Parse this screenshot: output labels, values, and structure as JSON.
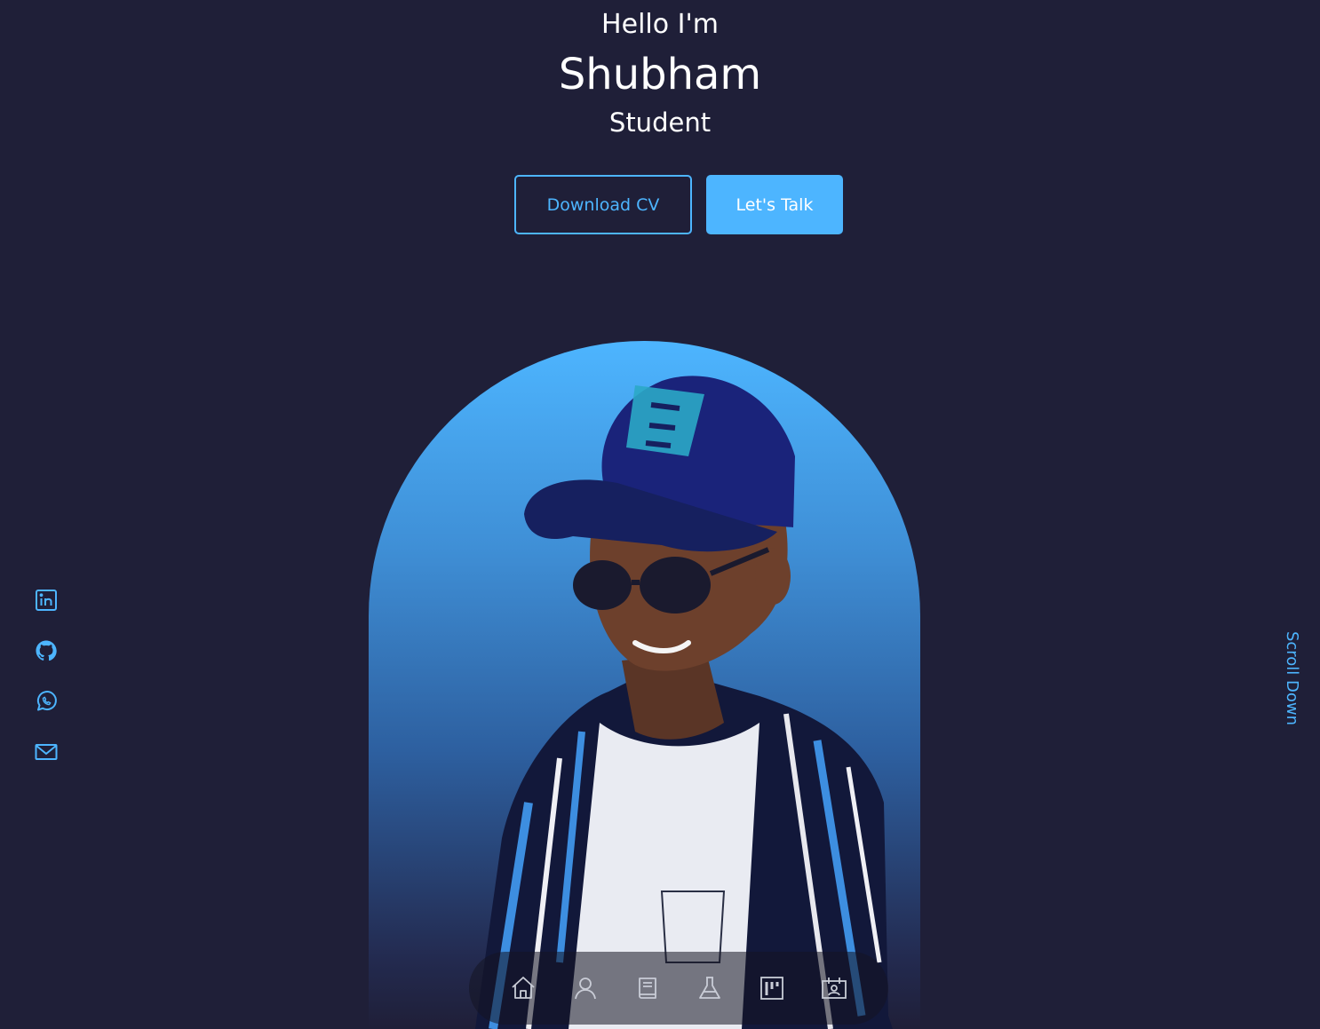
{
  "header": {
    "greeting": "Hello I'm",
    "name": "Shubham",
    "role": "Student"
  },
  "cta": {
    "download_label": "Download CV",
    "talk_label": "Let's Talk"
  },
  "scroll": {
    "label": "Scroll Down"
  },
  "socials": [
    {
      "icon": "linkedin-icon"
    },
    {
      "icon": "github-icon"
    },
    {
      "icon": "whatsapp-icon"
    },
    {
      "icon": "mail-icon"
    }
  ],
  "nav": [
    {
      "icon": "home-icon"
    },
    {
      "icon": "user-icon"
    },
    {
      "icon": "book-icon"
    },
    {
      "icon": "flask-icon"
    },
    {
      "icon": "board-icon"
    },
    {
      "icon": "contact-card-icon"
    }
  ],
  "colors": {
    "background": "#1f1f38",
    "accent": "#4db5ff",
    "text": "#ffffff"
  }
}
